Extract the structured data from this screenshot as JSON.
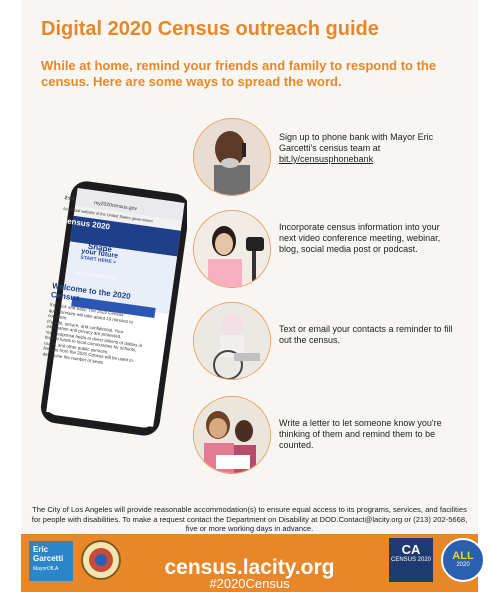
{
  "header": {
    "title": "Digital 2020 Census outreach guide",
    "subtitle": "While at home, remind your friends and family to respond to the census. Here are some ways to spread the word."
  },
  "items": [
    {
      "text": "Sign up to phone bank with Mayor Eric Garcetti's census team at",
      "link": "bit.ly/censusphonebank"
    },
    {
      "text": "Incorporate census information into your next video conference meeting, webinar, blog, social media post or podcast.",
      "link": ""
    },
    {
      "text": "Text or email your contacts a reminder to fill out the census.",
      "link": ""
    },
    {
      "text": "Write a letter to let someone know you're thinking of them and remind them to be counted.",
      "link": ""
    }
  ],
  "phone": {
    "time": "2:08",
    "url": "my2020census.gov",
    "banner": "An official website of the United States government",
    "brand": "Census 2020",
    "shape_line1": "Shape",
    "shape_line2": "your future",
    "start_here": "START HERE >",
    "start_button": "Start Questionnaire",
    "welcome": "Welcome to the 2020 Census",
    "bullets": [
      "It's quick and easy. The 2020 Census questionnaire will take about 10 minutes to complete.",
      "It's safe, secure, and confidential. Your information and privacy are protected.",
      "Your response helps to direct billions of dollars in federal funds to local communities for schools, roads, and other public services.",
      "Results from the 2020 Census will be used to determine the number of seats"
    ]
  },
  "footer": {
    "notice": "The City of Los Angeles will provide reasonable accommodation(s) to ensure equal access to its programs, services, and facilities for people with disabilities. To make a request contact the Department on Disability at DOD.Contact@lacity.org or (213) 202-5668, five or more working days in advance.",
    "url": "census.lacity.org",
    "hashtag": "#2020Census",
    "logo_eg_line1": "Eric",
    "logo_eg_line2": "Garcetti",
    "logo_eg_line3": "MayorOfLA",
    "ca_logo_big": "CA",
    "ca_logo_small": "CENSUS 2020",
    "all_logo_top": "CENSUS",
    "all_logo_big": "ALL",
    "all_logo_bottom": "2020"
  }
}
